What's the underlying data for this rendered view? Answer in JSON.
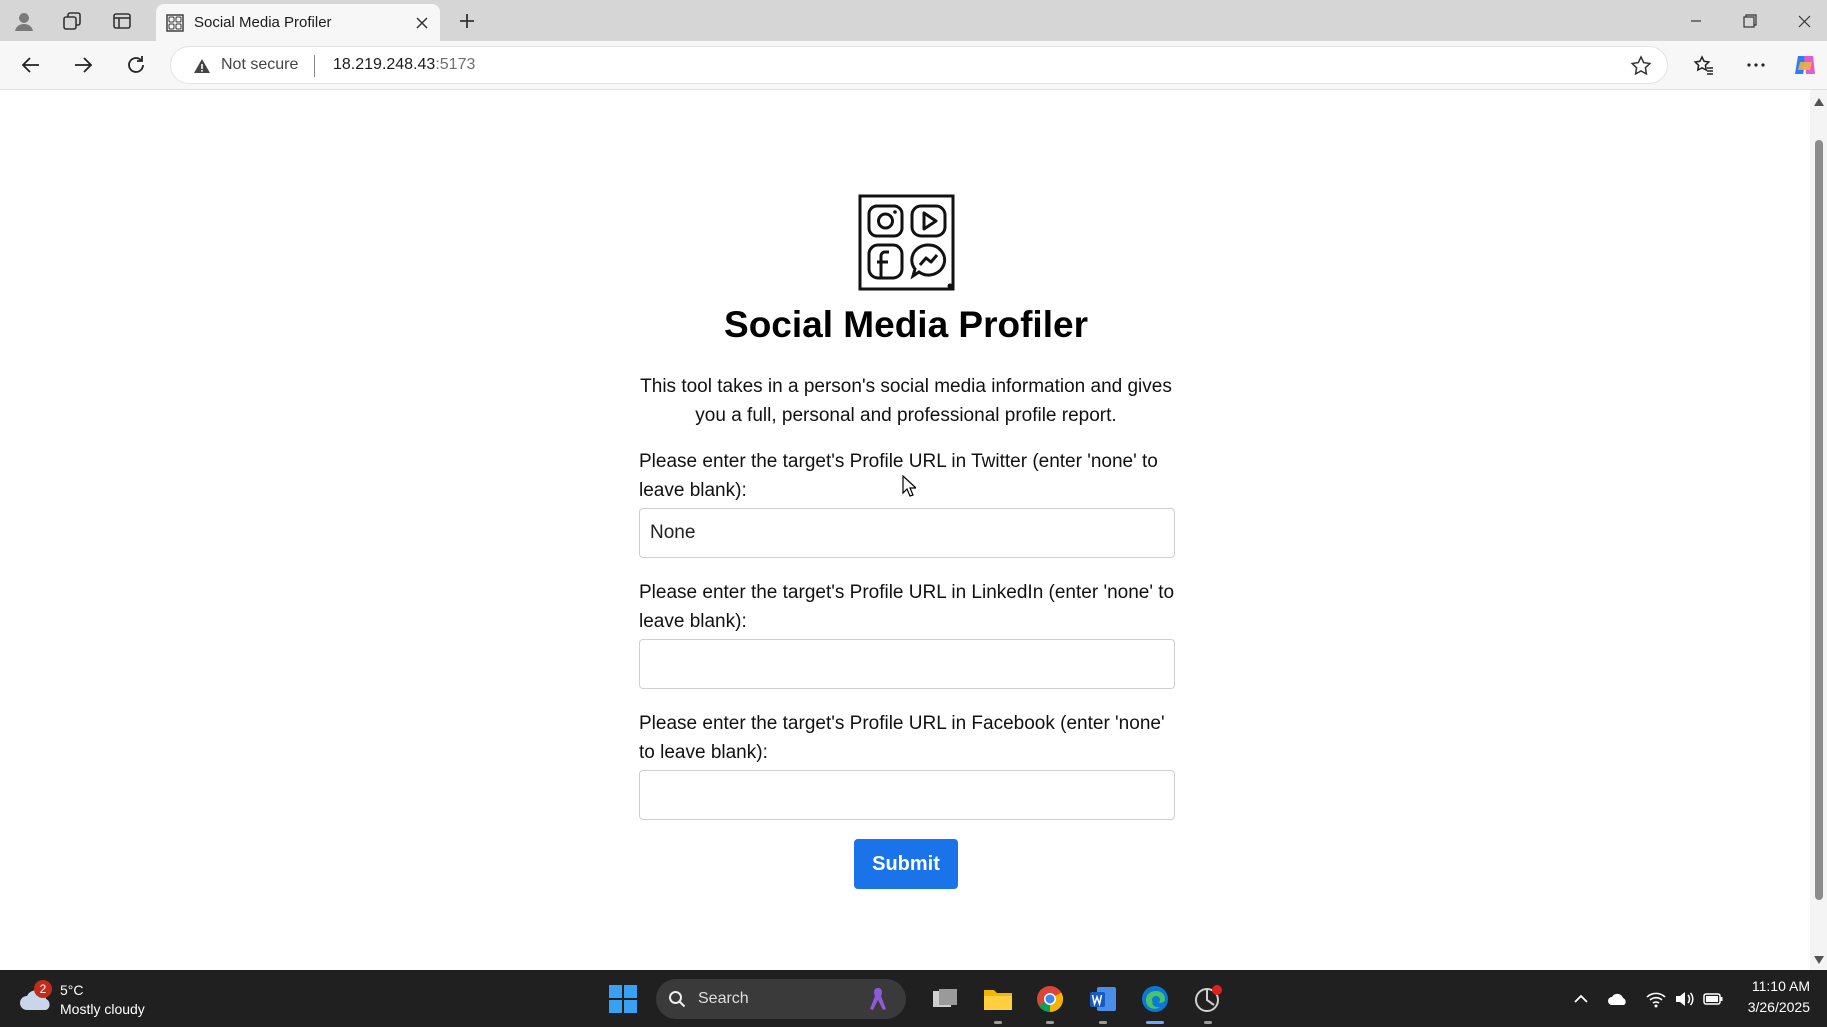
{
  "browser": {
    "tab_title": "Social Media Profiler",
    "security_label": "Not secure",
    "url_host": "18.219.248.43",
    "url_port": ":5173"
  },
  "page": {
    "heading": "Social Media Profiler",
    "description": "This tool takes in a person's social media information and gives you a full, personal and professional profile report.",
    "fields": [
      {
        "label": "Please enter the target's Profile URL in Twitter (enter 'none' to leave blank):",
        "value": "None"
      },
      {
        "label": "Please enter the target's Profile URL in LinkedIn (enter 'none' to leave blank):",
        "value": ""
      },
      {
        "label": "Please enter the target's Profile URL in Facebook (enter 'none' to leave blank):",
        "value": ""
      }
    ],
    "submit_label": "Submit",
    "accent_color": "#1a73e8"
  },
  "taskbar": {
    "weather_badge": "2",
    "temperature": "5°C",
    "condition": "Mostly cloudy",
    "search_label": "Search",
    "time": "11:10 AM",
    "date": "3/26/2025"
  }
}
